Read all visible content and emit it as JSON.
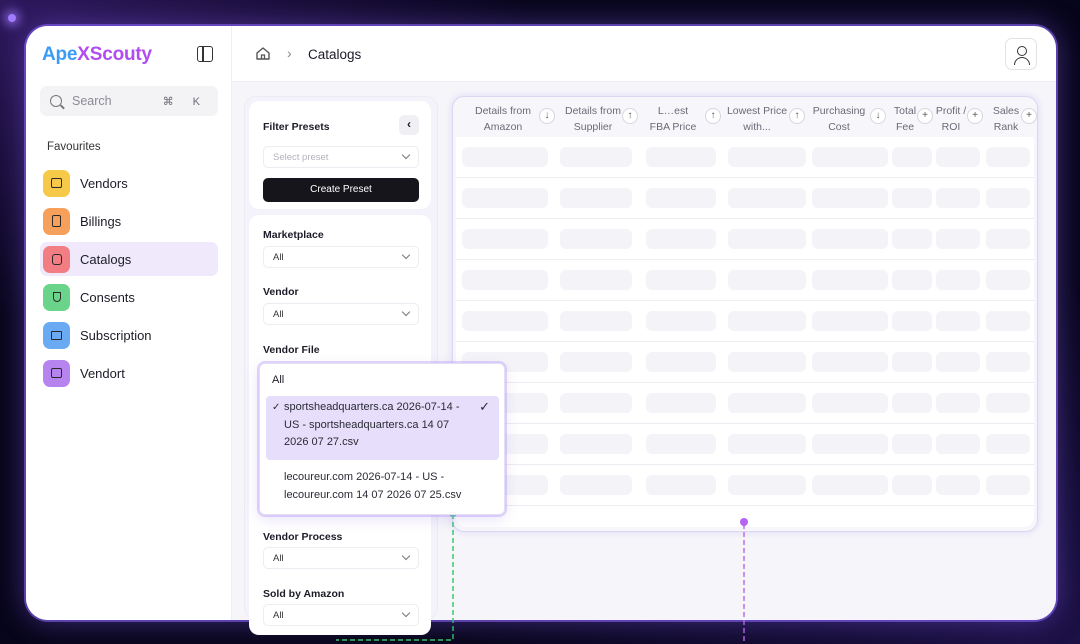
{
  "app": {
    "logo_part1": "Ape",
    "logo_mark": "X",
    "logo_part2": "Scouty"
  },
  "search": {
    "placeholder": "Search",
    "shortcut": "⌘ K"
  },
  "sidebar": {
    "section_label": "Favourites",
    "items": [
      {
        "label": "Vendors",
        "icon": "folder-icon",
        "color": "#f7c948"
      },
      {
        "label": "Billings",
        "icon": "receipt-icon",
        "color": "#f6a05c"
      },
      {
        "label": "Catalogs",
        "icon": "catalog-icon",
        "color": "#f27d82"
      },
      {
        "label": "Consents",
        "icon": "plug-icon",
        "color": "#6ad58a"
      },
      {
        "label": "Subscription",
        "icon": "crown-icon",
        "color": "#6aaaf3"
      },
      {
        "label": "Vendort",
        "icon": "folder-icon",
        "color": "#b684ef"
      }
    ],
    "active": "Catalogs"
  },
  "breadcrumb": {
    "current": "Catalogs"
  },
  "filters": {
    "presets_title": "Filter Presets",
    "preset_placeholder": "Select preset",
    "create_preset": "Create Preset",
    "marketplace_label": "Marketplace",
    "marketplace_value": "All",
    "vendor_label": "Vendor",
    "vendor_value": "All",
    "vendor_file_label": "Vendor File",
    "vendor_process_label": "Vendor Process",
    "vendor_process_value": "All",
    "sold_by_amazon_label": "Sold by Amazon",
    "sold_by_amazon_value": "All"
  },
  "vendor_file_dropdown": {
    "all": "All",
    "options": [
      {
        "line1": "sportsheadquarters.ca 2026-07-14 -",
        "line2": "US - sportsheadquarters.ca 14 07",
        "line3": "2026 07 27.csv",
        "selected": true
      },
      {
        "line1": "lecoureur.com 2026-07-14 - US -",
        "line2": "lecoureur.com 14 07 2026 07 25.csv",
        "selected": false
      }
    ]
  },
  "table": {
    "columns": [
      {
        "line1": "Details from",
        "line2": "Amazon"
      },
      {
        "line1": "Details from",
        "line2": "Supplier"
      },
      {
        "line1": "L…est",
        "line2": "FBA Price"
      },
      {
        "line1": "Lowest Price",
        "line2": "with..."
      },
      {
        "line1": "Purchasing",
        "line2": "Cost"
      },
      {
        "line1": "Total",
        "line2": "Fee"
      },
      {
        "line1": "Profit /",
        "line2": "ROI"
      },
      {
        "line1": "Sales",
        "line2": "Rank"
      }
    ],
    "sort_icons": [
      "arrow-down-icon",
      "arrow-up-icon",
      "arrow-up-icon",
      "arrow-up-icon",
      "arrow-down-icon",
      "plus-icon",
      "plus-icon",
      "plus-icon"
    ]
  },
  "colors": {
    "accent": "#b684ef",
    "active_bg": "#efe9fb",
    "connector_green": "#2fc46b",
    "connector_purple": "#b664f2"
  }
}
